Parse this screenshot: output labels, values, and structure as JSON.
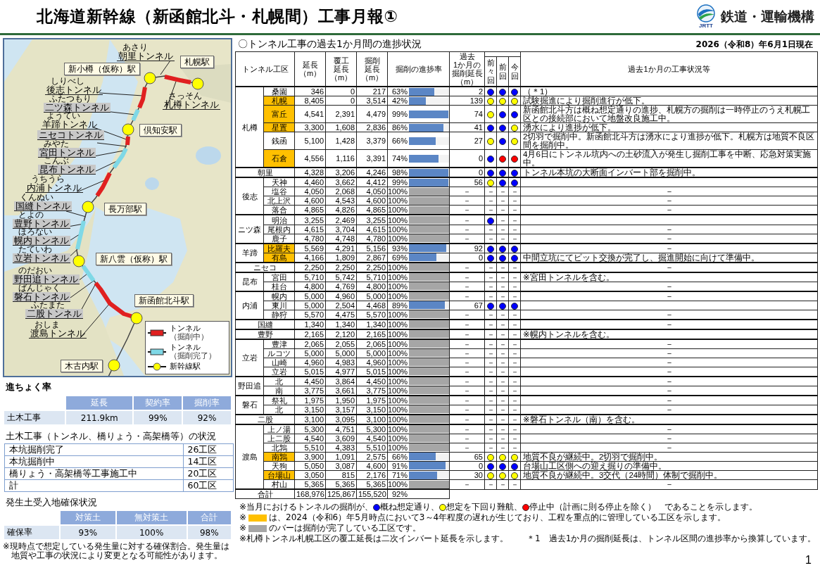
{
  "title": "北海道新幹線（新函館北斗・札幌間）工事月報①",
  "logo": {
    "name": "鉄道・運輸機構",
    "abbr": "JRTT"
  },
  "map": {
    "stations": [
      {
        "name": "新小樽（仮称）駅"
      },
      {
        "name": "札幌駅"
      },
      {
        "name": "倶知安駅"
      },
      {
        "name": "長万部駅"
      },
      {
        "name": "新八雲（仮称）駅"
      },
      {
        "name": "新函館北斗駅"
      },
      {
        "name": "木古内駅"
      }
    ],
    "tunnels": [
      {
        "reading": "あさり",
        "name": "朝里トンネル",
        "complete": false
      },
      {
        "reading": "しりべし",
        "name": "後志トンネル",
        "complete": false
      },
      {
        "reading": "ふたつもり",
        "name": "二ツ森トンネル",
        "complete": true
      },
      {
        "reading": "ようてい",
        "name": "羊蹄トンネル",
        "complete": false
      },
      {
        "reading": "さっそん",
        "name": "札樽トンネル",
        "complete": false
      },
      {
        "name": "ニセコトンネル",
        "complete": true
      },
      {
        "reading": "みやた",
        "name": "宮田トンネル",
        "complete": true
      },
      {
        "reading": "こんぶ",
        "name": "昆布トンネル",
        "complete": true
      },
      {
        "reading": "うちうら",
        "name": "内浦トンネル",
        "complete": false
      },
      {
        "reading": "くんぬい",
        "name": "国縫トンネル",
        "complete": true
      },
      {
        "reading": "とよの",
        "name": "豊野トンネル",
        "complete": true
      },
      {
        "reading": "ほろない",
        "name": "幌内トンネル",
        "complete": true
      },
      {
        "reading": "たていわ",
        "name": "立岩トンネル",
        "complete": true
      },
      {
        "reading": "のだおい",
        "name": "野田追トンネル",
        "complete": true
      },
      {
        "reading": "ばんじゃく",
        "name": "磐石トンネル",
        "complete": true
      },
      {
        "reading": "ふたまた",
        "name": "二股トンネル",
        "complete": true
      },
      {
        "reading": "おしま",
        "name": "渡島トンネル",
        "complete": false
      }
    ],
    "legend": [
      {
        "kind": "excavating",
        "label": "トンネル",
        "sub": "（掘削中）"
      },
      {
        "kind": "complete",
        "label": "トンネル",
        "sub": "（掘削完了）"
      },
      {
        "kind": "station",
        "label": "新幹線駅"
      }
    ]
  },
  "progress": {
    "title": "進ちょく率",
    "columns": [
      "延長",
      "契約率",
      "掘削率"
    ],
    "rows": [
      {
        "label": "土木工事",
        "values": [
          "211.9km",
          "99%",
          "92%"
        ]
      }
    ]
  },
  "status": {
    "title": "土木工事（トンネル、橋りょう・高架橋等）の状況",
    "rows": [
      {
        "label": "本坑掘削完了",
        "value": "26工区"
      },
      {
        "label": "本坑掘削中",
        "value": "14工区"
      },
      {
        "label": "橋りょう・高架橋等工事施工中",
        "value": "20工区"
      },
      {
        "label": "計",
        "value": "60工区"
      }
    ]
  },
  "soil": {
    "title": "発生土受入地確保状況",
    "columns": [
      "対策土",
      "無対策土",
      "合計"
    ],
    "rows": [
      {
        "label": "確保率",
        "values": [
          "93%",
          "100%",
          "98%"
        ]
      }
    ],
    "note": "※現時点で想定している発生量に対する確保割合。発生量は地質や工事の状況により変更となる可能性があります。"
  },
  "section_title": "〇トンネル工事の過去1か月間の進捗状況",
  "date": "2026（令和8）年6月1日現在",
  "columns": [
    [
      "トンネル工区"
    ],
    [
      "延長",
      "（m）"
    ],
    [
      "覆工",
      "延長",
      "（m）"
    ],
    [
      "掘削",
      "延長",
      "（m）"
    ],
    [
      "掘削の進捗率"
    ],
    [
      "過去",
      "1か月の",
      "掘削延長",
      "（m）"
    ],
    [
      "前々回"
    ],
    [
      "前回"
    ],
    [
      "今回"
    ],
    [
      "過去1か月の工事状況等"
    ]
  ],
  "groups": [
    {
      "kind": "group",
      "name": "札樽",
      "tunnels": [
        {
          "name": "桑園",
          "priority": false,
          "length": "346",
          "lining": "0",
          "excavated": "217",
          "rate": "63%",
          "level": 0.63,
          "recent": "2",
          "dots": [
            {
              "color": "#0000ff"
            },
            {
              "color": "#0000ff"
            },
            {
              "color": "#0000ff"
            }
          ],
          "note": "（＊1）"
        },
        {
          "name": "札幌",
          "priority": true,
          "length": "8,405",
          "lining": "0",
          "excavated": "3,514",
          "rate": "42%",
          "level": 0.42,
          "recent": "139",
          "dots": [
            {
              "color": "#ffff00"
            },
            {
              "color": "#ffff00"
            },
            {
              "color": "#ffff00"
            }
          ],
          "note": "試験掘進により掘削進行が低下。"
        },
        {
          "name": "富丘",
          "priority": true,
          "length": "4,541",
          "lining": "2,391",
          "excavated": "4,479",
          "rate": "99%",
          "level": 0.99,
          "recent": "74",
          "dots": [
            {
              "color": "#ffff00"
            },
            {
              "color": "#0000ff"
            },
            {
              "color": "#0000ff"
            }
          ],
          "note": "新函館北斗方は概ね想定通りの進捗、札幌方の掘削は一時停止のうえ札幌工区との接続部において地盤改良施工中。"
        },
        {
          "name": "星置",
          "priority": true,
          "length": "3,300",
          "lining": "1,608",
          "excavated": "2,836",
          "rate": "86%",
          "level": 0.86,
          "recent": "41",
          "dots": [
            {
              "color": "#0000ff"
            },
            {
              "color": "#0000ff"
            },
            {
              "color": "#ffff00"
            }
          ],
          "note": "湧水により進捗が低下。"
        },
        {
          "name": "銭函",
          "priority": false,
          "length": "5,100",
          "lining": "1,428",
          "excavated": "3,379",
          "rate": "66%",
          "level": 0.66,
          "recent": "27",
          "dots": [
            {
              "color": "#ffff00"
            },
            {
              "color": "#0000ff"
            },
            {
              "color": "#ffff00"
            }
          ],
          "note": "2切羽で掘削中。新函館北斗方は湧水により進捗が低下。札幌方は地質不良区間を掘削中。"
        },
        {
          "name": "石倉",
          "priority": true,
          "length": "4,556",
          "lining": "1,116",
          "excavated": "3,391",
          "rate": "74%",
          "level": 0.74,
          "recent": "0",
          "dots": [
            {
              "color": "#0000ff"
            },
            {
              "color": "#ff0000"
            },
            {
              "color": "#ff0000"
            }
          ],
          "note": "4月6日にトンネル坑内への土砂流入が発生し掘削工事を中断、応急対策実施中。"
        }
      ]
    },
    {
      "kind": "single",
      "name": "朝里",
      "length": "4,328",
      "lining": "3,206",
      "excavated": "4,246",
      "rate": "98%",
      "level": 0.98,
      "recent": "0",
      "dots": [
        {
          "color": "#0000ff"
        },
        {
          "color": "#0000ff"
        },
        {
          "color": "#0000ff"
        }
      ],
      "note": "トンネル本坑の大断面インバート部を掘削中。"
    },
    {
      "kind": "group",
      "name": "後志",
      "tunnels": [
        {
          "name": "天神",
          "priority": false,
          "length": "4,460",
          "lining": "3,662",
          "excavated": "4,412",
          "rate": "99%",
          "level": 0.99,
          "recent": "56",
          "dots": [
            {
              "color": "#ffff00"
            },
            {
              "color": "#0000ff"
            },
            {
              "color": "#0000ff"
            }
          ]
        },
        {
          "name": "塩谷",
          "priority": false,
          "length": "4,050",
          "lining": "2,068",
          "excavated": "4,050",
          "rate": "100%",
          "level": 1,
          "recent": "－",
          "dots": [
            {
              "text": "－"
            },
            {
              "text": "－"
            },
            {
              "text": "－"
            }
          ],
          "note": "－"
        },
        {
          "name": "北上沢",
          "priority": false,
          "length": "4,600",
          "lining": "4,543",
          "excavated": "4,600",
          "rate": "100%",
          "level": 1,
          "recent": "－",
          "dots": [
            {
              "text": "－"
            },
            {
              "text": "－"
            },
            {
              "text": "－"
            }
          ],
          "note": "－"
        },
        {
          "name": "落合",
          "priority": false,
          "length": "4,865",
          "lining": "4,826",
          "excavated": "4,865",
          "rate": "100%",
          "level": 1,
          "recent": "－",
          "dots": [
            {
              "text": "－"
            },
            {
              "text": "－"
            },
            {
              "text": "－"
            }
          ],
          "note": "－"
        }
      ]
    },
    {
      "kind": "group",
      "name": "ニツ森",
      "tunnels": [
        {
          "name": "明治",
          "priority": false,
          "length": "3,255",
          "lining": "2,469",
          "excavated": "3,255",
          "rate": "100%",
          "level": 1,
          "recent": "－",
          "dots": [
            {
              "color": "#0000ff"
            },
            {
              "text": "－"
            },
            {
              "text": "－"
            }
          ]
        },
        {
          "name": "尾根内",
          "priority": false,
          "length": "4,615",
          "lining": "3,704",
          "excavated": "4,615",
          "rate": "100%",
          "level": 1,
          "recent": "－",
          "dots": [
            {
              "text": "－"
            },
            {
              "text": "－"
            },
            {
              "text": "－"
            }
          ],
          "note": "－"
        },
        {
          "name": "鹿子",
          "priority": false,
          "length": "4,780",
          "lining": "4,748",
          "excavated": "4,780",
          "rate": "100%",
          "level": 1,
          "recent": "－",
          "dots": [
            {
              "text": "－"
            },
            {
              "text": "－"
            },
            {
              "text": "－"
            }
          ],
          "note": "－"
        }
      ]
    },
    {
      "kind": "group",
      "name": "羊蹄",
      "tunnels": [
        {
          "name": "比羅夫",
          "priority": true,
          "length": "5,569",
          "lining": "4,291",
          "excavated": "5,156",
          "rate": "93%",
          "level": 0.93,
          "recent": "92",
          "dots": [
            {
              "color": "#0000ff"
            },
            {
              "color": "#0000ff"
            },
            {
              "color": "#0000ff"
            }
          ],
          "note": "－"
        },
        {
          "name": "有島",
          "priority": true,
          "length": "4,166",
          "lining": "1,809",
          "excavated": "2,867",
          "rate": "69%",
          "level": 0.69,
          "recent": "0",
          "dots": [
            {
              "color": "#0000ff"
            },
            {
              "color": "#0000ff"
            },
            {
              "color": "#0000ff"
            }
          ],
          "note": "中間立坑にてビット交換が完了し、掘進開始に向けて準備中。"
        }
      ]
    },
    {
      "kind": "single",
      "name": "ニセコ",
      "length": "2,250",
      "lining": "2,250",
      "excavated": "2,250",
      "rate": "100%",
      "level": 1,
      "recent": "－",
      "dots": [
        {
          "text": "－"
        },
        {
          "text": "－"
        },
        {
          "text": "－"
        }
      ],
      "note": "－"
    },
    {
      "kind": "group",
      "name": "昆布",
      "tunnels": [
        {
          "name": "宮田",
          "priority": false,
          "length": "5,710",
          "lining": "5,742",
          "excavated": "5,710",
          "rate": "100%",
          "level": 1,
          "recent": "－",
          "dots": [
            {
              "text": "－"
            },
            {
              "text": "－"
            },
            {
              "text": "－"
            }
          ],
          "note": "※宮田トンネルを含む。"
        },
        {
          "name": "桂台",
          "priority": false,
          "length": "4,800",
          "lining": "4,769",
          "excavated": "4,800",
          "rate": "100%",
          "level": 1,
          "recent": "－",
          "dots": [
            {
              "text": "－"
            },
            {
              "text": "－"
            },
            {
              "text": "－"
            }
          ],
          "note": "－"
        }
      ]
    },
    {
      "kind": "group",
      "name": "内浦",
      "tunnels": [
        {
          "name": "幌内",
          "priority": false,
          "length": "5,000",
          "lining": "4,960",
          "excavated": "5,000",
          "rate": "100%",
          "level": 1,
          "recent": "－",
          "dots": [
            {
              "text": "－"
            },
            {
              "text": "－"
            },
            {
              "text": "－"
            }
          ],
          "note": "－"
        },
        {
          "name": "東川",
          "priority": false,
          "length": "5,000",
          "lining": "2,504",
          "excavated": "4,468",
          "rate": "89%",
          "level": 0.89,
          "recent": "67",
          "dots": [
            {
              "color": "#0000ff"
            },
            {
              "color": "#0000ff"
            },
            {
              "color": "#0000ff"
            }
          ]
        },
        {
          "name": "静狩",
          "priority": false,
          "length": "5,570",
          "lining": "4,475",
          "excavated": "5,570",
          "rate": "100%",
          "level": 1,
          "recent": "－",
          "dots": [
            {
              "text": "－"
            },
            {
              "text": "－"
            },
            {
              "text": "－"
            }
          ],
          "note": "－"
        }
      ]
    },
    {
      "kind": "single",
      "name": "国縫",
      "length": "1,340",
      "lining": "1,340",
      "excavated": "1,340",
      "rate": "100%",
      "level": 1,
      "recent": "－",
      "dots": [
        {
          "text": "－"
        },
        {
          "text": "－"
        },
        {
          "text": "－"
        }
      ],
      "note": "－"
    },
    {
      "kind": "single",
      "name": "豊野",
      "length": "2,165",
      "lining": "2,120",
      "excavated": "2,165",
      "rate": "100%",
      "level": 1,
      "recent": "－",
      "dots": [
        {
          "text": "－"
        },
        {
          "text": "－"
        },
        {
          "text": "－"
        }
      ],
      "note": "※幌内トンネルを含む。"
    },
    {
      "kind": "group",
      "name": "立岩",
      "tunnels": [
        {
          "name": "豊津",
          "priority": false,
          "length": "2,065",
          "lining": "2,055",
          "excavated": "2,065",
          "rate": "100%",
          "level": 1,
          "recent": "－",
          "dots": [
            {
              "text": "－"
            },
            {
              "text": "－"
            },
            {
              "text": "－"
            }
          ],
          "note": "－"
        },
        {
          "name": "ルコツ",
          "priority": false,
          "length": "5,000",
          "lining": "5,000",
          "excavated": "5,000",
          "rate": "100%",
          "level": 1,
          "recent": "－",
          "dots": [
            {
              "text": "－"
            },
            {
              "text": "－"
            },
            {
              "text": "－"
            }
          ],
          "note": "－"
        },
        {
          "name": "山崎",
          "priority": false,
          "length": "4,960",
          "lining": "4,983",
          "excavated": "4,960",
          "rate": "100%",
          "level": 1,
          "recent": "－",
          "dots": [
            {
              "text": "－"
            },
            {
              "text": "－"
            },
            {
              "text": "－"
            }
          ],
          "note": "－"
        },
        {
          "name": "立岩",
          "priority": false,
          "length": "5,015",
          "lining": "4,977",
          "excavated": "5,015",
          "rate": "100%",
          "level": 1,
          "recent": "－",
          "dots": [
            {
              "text": "－"
            },
            {
              "text": "－"
            },
            {
              "text": "－"
            }
          ],
          "note": "－"
        }
      ]
    },
    {
      "kind": "group",
      "name": "野田追",
      "tunnels": [
        {
          "name": "北",
          "priority": false,
          "length": "4,450",
          "lining": "3,864",
          "excavated": "4,450",
          "rate": "100%",
          "level": 1,
          "recent": "－",
          "dots": [
            {
              "text": "－"
            },
            {
              "text": "－"
            },
            {
              "text": "－"
            }
          ],
          "note": "－"
        },
        {
          "name": "南",
          "priority": false,
          "length": "3,775",
          "lining": "3,661",
          "excavated": "3,775",
          "rate": "100%",
          "level": 1,
          "recent": "－",
          "dots": [
            {
              "text": "－"
            },
            {
              "text": "－"
            },
            {
              "text": "－"
            }
          ],
          "note": "－"
        }
      ]
    },
    {
      "kind": "group",
      "name": "磐石",
      "tunnels": [
        {
          "name": "祭礼",
          "priority": false,
          "length": "1,975",
          "lining": "1,950",
          "excavated": "1,975",
          "rate": "100%",
          "level": 1,
          "recent": "－",
          "dots": [
            {
              "text": "－"
            },
            {
              "text": "－"
            },
            {
              "text": "－"
            }
          ],
          "note": "－"
        },
        {
          "name": "北",
          "priority": false,
          "length": "3,150",
          "lining": "3,157",
          "excavated": "3,150",
          "rate": "100%",
          "level": 1,
          "recent": "－",
          "dots": [
            {
              "text": "－"
            },
            {
              "text": "－"
            },
            {
              "text": "－"
            }
          ],
          "note": "－"
        }
      ]
    },
    {
      "kind": "single",
      "name": "二股",
      "length": "3,100",
      "lining": "3,095",
      "excavated": "3,100",
      "rate": "100%",
      "level": 1,
      "recent": "－",
      "dots": [
        {
          "text": "－"
        },
        {
          "text": "－"
        },
        {
          "text": "－"
        }
      ],
      "note": "※磐石トンネル（南）を含む。"
    },
    {
      "kind": "group",
      "name": "渡島",
      "tunnels": [
        {
          "name": "上ノ湯",
          "priority": false,
          "length": "5,300",
          "lining": "4,751",
          "excavated": "5,300",
          "rate": "100%",
          "level": 1,
          "recent": "－",
          "dots": [
            {
              "text": "－"
            },
            {
              "text": "－"
            },
            {
              "text": "－"
            }
          ],
          "note": "－"
        },
        {
          "name": "上二股",
          "priority": false,
          "length": "4,540",
          "lining": "3,609",
          "excavated": "4,540",
          "rate": "100%",
          "level": 1,
          "recent": "－",
          "dots": [
            {
              "text": "－"
            },
            {
              "text": "－"
            },
            {
              "text": "－"
            }
          ],
          "note": "－"
        },
        {
          "name": "北鶉",
          "priority": false,
          "length": "5,510",
          "lining": "4,383",
          "excavated": "5,510",
          "rate": "100%",
          "level": 1,
          "recent": "－",
          "dots": [
            {
              "text": "－"
            },
            {
              "text": "－"
            },
            {
              "text": "－"
            }
          ],
          "note": "－"
        },
        {
          "name": "南鶉",
          "priority": true,
          "length": "3,900",
          "lining": "1,091",
          "excavated": "2,575",
          "rate": "66%",
          "level": 0.66,
          "recent": "65",
          "dots": [
            {
              "color": "#ffff00"
            },
            {
              "color": "#ffff00"
            },
            {
              "color": "#ffff00"
            }
          ],
          "note": "地質不良が継続中。2切羽で掘削中。"
        },
        {
          "name": "天狗",
          "priority": false,
          "length": "5,050",
          "lining": "3,087",
          "excavated": "4,600",
          "rate": "91%",
          "level": 0.91,
          "recent": "0",
          "dots": [
            {
              "color": "#0000ff"
            },
            {
              "color": "#0000ff"
            },
            {
              "color": "#0000ff"
            }
          ],
          "note": "台場山工区側への迎え掘りの準備中。"
        },
        {
          "name": "台場山",
          "priority": true,
          "length": "3,050",
          "lining": "815",
          "excavated": "2,176",
          "rate": "71%",
          "level": 0.71,
          "recent": "30",
          "dots": [
            {
              "color": "#ffff00"
            },
            {
              "color": "#ffff00"
            },
            {
              "color": "#ffff00"
            }
          ],
          "note": "地質不良が継続中。3交代（24時間）体制で掘削中。"
        },
        {
          "name": "村山",
          "priority": false,
          "length": "5,365",
          "lining": "5,365",
          "excavated": "5,365",
          "rate": "100%",
          "level": 1,
          "recent": "－",
          "dots": [
            {
              "text": "－"
            },
            {
              "text": "－"
            },
            {
              "text": "－"
            }
          ],
          "note": "－"
        }
      ]
    }
  ],
  "total": {
    "label": "合計",
    "length": "168,976",
    "lining": "125,867",
    "excavated": "155,520",
    "rate": "92%"
  },
  "footnotes": [
    {
      "parts": [
        {
          "kind": "text",
          "text": "※当月におけるトンネルの掘削が、"
        },
        {
          "kind": "dot",
          "color": "#0000ff"
        },
        {
          "kind": "text",
          "text": "概ね想定通り、"
        },
        {
          "kind": "dot",
          "color": "#ffff00"
        },
        {
          "kind": "text",
          "text": "想定を下回り難航、"
        },
        {
          "kind": "dot",
          "color": "#ff0000"
        },
        {
          "kind": "text",
          "text": "停止中（計画に則る停止を除く）　であることを示します。"
        }
      ]
    },
    {
      "parts": [
        {
          "kind": "text",
          "text": "※"
        },
        {
          "kind": "swatch",
          "color": "#ffc000"
        },
        {
          "kind": "text",
          "text": "は、2024（令和6）年5月時点において3～4年程度の遅れが生じており、工程を重点的に管理している工区を示します。"
        }
      ]
    },
    {
      "parts": [
        {
          "kind": "text",
          "text": "※"
        },
        {
          "kind": "swatch",
          "color": "#a6a6a6"
        },
        {
          "kind": "text",
          "text": "のバーは掘削が完了している工区です。"
        }
      ]
    },
    {
      "parts": [
        {
          "kind": "text",
          "text": "※札樽トンネル札幌工区の覆工延長は二次インバート延長を示します。"
        },
        {
          "kind": "text",
          "text": "＊1　過去1か月の掘削延長は、トンネル区間の進捗率から換算しています。"
        }
      ]
    }
  ],
  "page_number": "1"
}
